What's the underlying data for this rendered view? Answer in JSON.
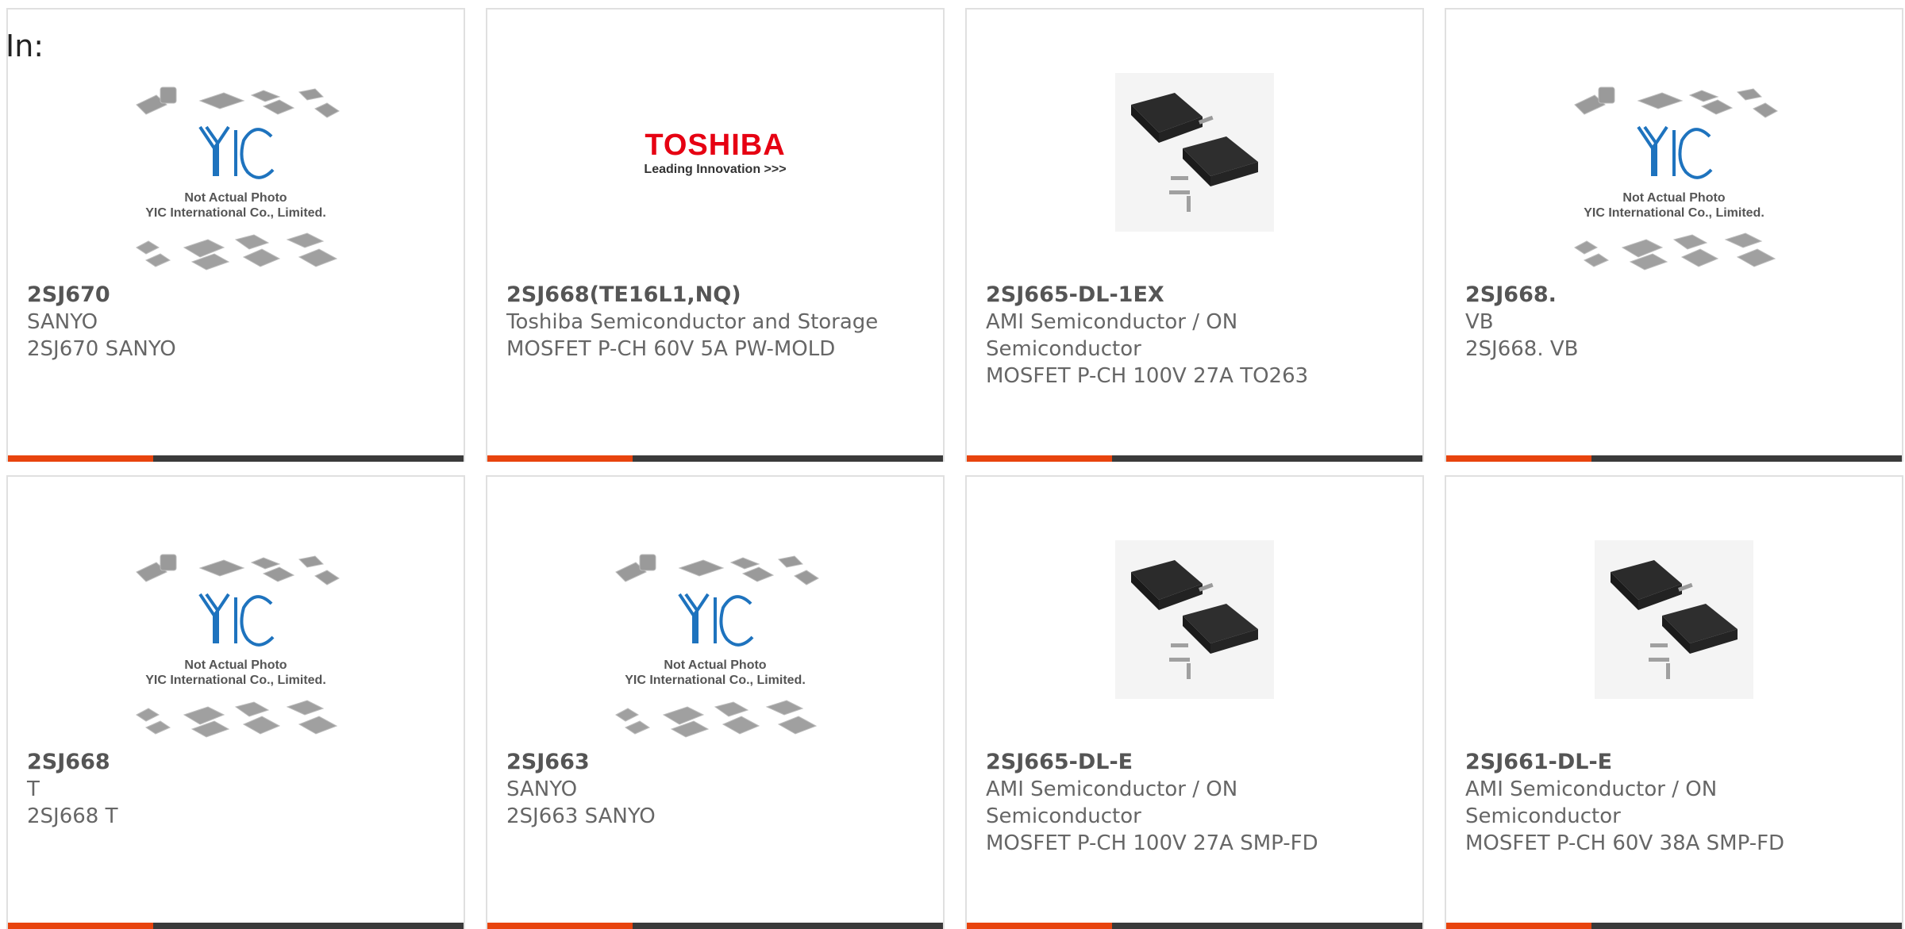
{
  "header": {
    "label": "In:"
  },
  "placeholder": {
    "line1": "Not Actual Photo",
    "line2": "YIC International Co., Limited."
  },
  "toshiba_logo": {
    "brand": "TOSHIBA",
    "tagline": "Leading Innovation >>>"
  },
  "colors": {
    "accent": "#e8440e",
    "bar": "#3a3a3a",
    "border": "#e0e0e0"
  },
  "products": [
    {
      "part": "2SJ670",
      "manufacturer": "SANYO",
      "description": "2SJ670 SANYO",
      "image": "yic-placeholder"
    },
    {
      "part": "2SJ668(TE16L1,NQ)",
      "manufacturer": "Toshiba Semiconductor and Storage",
      "description": "MOSFET P-CH 60V 5A PW-MOLD",
      "image": "toshiba-logo"
    },
    {
      "part": "2SJ665-DL-1EX",
      "manufacturer": "AMI Semiconductor / ON Semiconductor",
      "description": "MOSFET P-CH 100V 27A TO263",
      "image": "to263-package"
    },
    {
      "part": "2SJ668.",
      "manufacturer": "VB",
      "description": "2SJ668. VB",
      "image": "yic-placeholder"
    },
    {
      "part": "2SJ668",
      "manufacturer": "T",
      "description": "2SJ668 T",
      "image": "yic-placeholder"
    },
    {
      "part": "2SJ663",
      "manufacturer": "SANYO",
      "description": "2SJ663 SANYO",
      "image": "yic-placeholder"
    },
    {
      "part": "2SJ665-DL-E",
      "manufacturer": "AMI Semiconductor / ON Semiconductor",
      "description": "MOSFET P-CH 100V 27A SMP-FD",
      "image": "to263-package"
    },
    {
      "part": "2SJ661-DL-E",
      "manufacturer": "AMI Semiconductor / ON Semiconductor",
      "description": "MOSFET P-CH 60V 38A SMP-FD",
      "image": "to263-package"
    }
  ]
}
